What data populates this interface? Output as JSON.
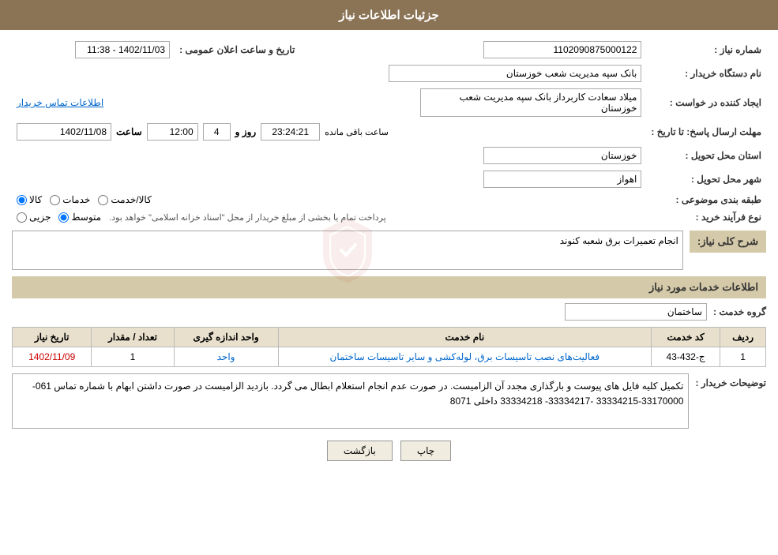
{
  "page": {
    "title": "جزئیات اطلاعات نیاز",
    "header": {
      "bg_color": "#8b7355",
      "text": "جزئیات اطلاعات نیاز"
    }
  },
  "fields": {
    "shomare_niaz_label": "شماره نیاز :",
    "shomare_niaz_value": "1102090875000122",
    "nam_dastgah_label": "نام دستگاه خریدار :",
    "nam_dastgah_value": "بانک سپه مدیریت شعب خوزستان",
    "ijad_konande_label": "ایجاد کننده در خواست :",
    "ijad_konande_value": "میلاد سعادت کاربرداز بانک سپه مدیریت شعب خوزستان",
    "ittilaat_tamas_label": "اطلاعات تماس خریدار",
    "mohlat_ersal_label": "مهلت ارسال پاسخ: تا تاریخ :",
    "date_value": "1402/11/08",
    "saat_label": "ساعت",
    "saat_value": "12:00",
    "roz_value": "4",
    "va_label": "روز و",
    "baqi_saat_label": "ساعت باقی مانده",
    "countdown_value": "23:24:21",
    "ostan_label": "استان محل تحویل :",
    "ostan_value": "خوزستان",
    "shahr_label": "شهر محل تحویل :",
    "shahr_value": "اهواز",
    "tarifbandi_label": "طبقه بندی موضوعی :",
    "radio_kala": "کالا",
    "radio_khadamat": "خدمات",
    "radio_kala_khadamat": "کالا/خدمت",
    "now_farayand_label": "نوع فرآیند خرید :",
    "radio_jozee": "جزیی",
    "radio_motavassit": "متوسط",
    "radio_text": "پرداخت تمام یا بخشی از مبلغ خریدار از محل \"اسناد خزانه اسلامی\" خواهد بود.",
    "sharh_label": "شرح کلی نیاز:",
    "sharh_value": "انجام تعمیرات برق شعبه کنوند",
    "services_title": "اطلاعات خدمات مورد نیاز",
    "group_khadamat_label": "گروه خدمت :",
    "group_khadamat_value": "ساختمان",
    "table_headers": [
      "ردیف",
      "کد خدمت",
      "نام خدمت",
      "واحد اندازه گیری",
      "تعداد / مقدار",
      "تاریخ نیاز"
    ],
    "table_rows": [
      {
        "radif": "1",
        "kod_khadamat": "ج-432-43",
        "nam_khadamat": "فعالیت‌های نصب تاسیسات برق، لوله‌کشی و سایر تاسیسات ساختمان",
        "vahed": "واحد",
        "tedad": "1",
        "tarikh": "1402/11/09"
      }
    ],
    "description_label": "توضیحات خریدار :",
    "description_text": "تکمیل کلیه فایل های پیوست و بارگذاری مجدد آن الزامیست. در صورت عدم انجام استعلام ابطال می گردد. بازدید الزامیست در صورت داشتن ابهام با شماره تماس 061-33170000-33334215 -33334217- 33334218 داخلی 8071",
    "buttons": {
      "chap": "چاپ",
      "bazgasht": "بازگشت"
    },
    "tarikh_aalan_label": "تاریخ و ساعت اعلان عمومی :",
    "tarikh_aalan_value": "1402/11/03 - 11:38"
  }
}
